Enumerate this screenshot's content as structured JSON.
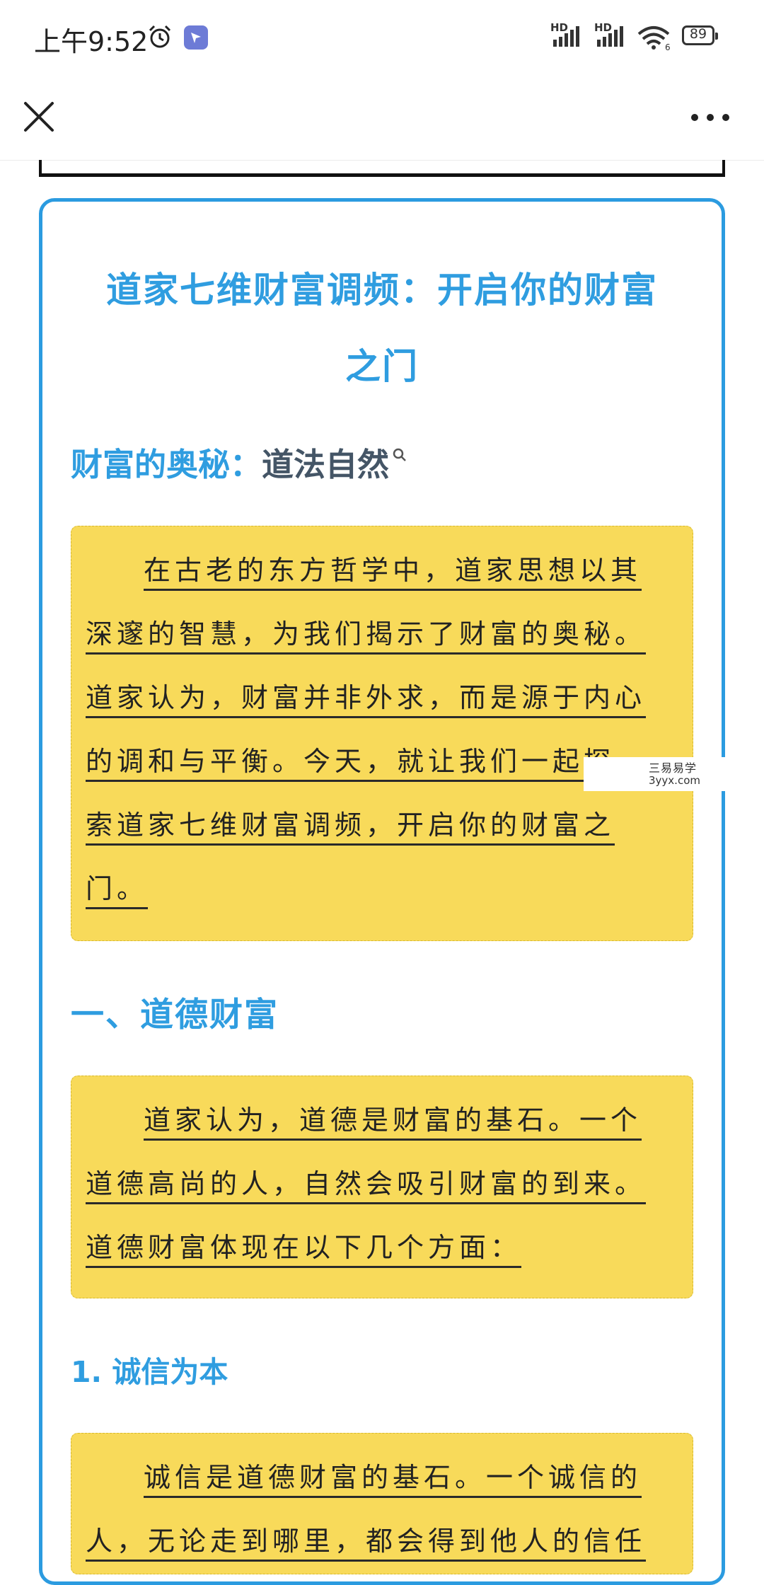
{
  "status": {
    "time": "上午9:52",
    "sim1": "HD",
    "sim2": "HD",
    "wifi_badge": "6",
    "battery": "89"
  },
  "nav": {
    "close_icon": "close-icon",
    "more_icon": "more-icon"
  },
  "article": {
    "title_line1": "道家七维财富调频：开启你的财富",
    "title_line2": "之门",
    "subhead_label": "财富的奥秘：",
    "subhead_text": "道法自然",
    "intro_lines": [
      "在古老的东方哲学中，道家思想以其",
      "深邃的智慧，为我们揭示了财富的奥秘。",
      "道家认为，财富并非外求，而是源于内心",
      "的调和与平衡。今天，就让我们一起探",
      "索道家七维财富调频，开启你的财富之",
      "门。"
    ],
    "section1_title": "一、道德财富",
    "section1_lines": [
      "道家认为，道德是财富的基石。一个",
      "道德高尚的人，自然会吸引财富的到来。",
      "道德财富体现在以下几个方面："
    ],
    "sub1_title": "1. 诚信为本",
    "sub1_lines": [
      "诚信是道德财富的基石。一个诚信的",
      "人，无论走到哪里，都会得到他人的信任"
    ]
  },
  "watermark": {
    "line1": "三易易学",
    "line2": "3yyx.com"
  },
  "colors": {
    "accent": "#2f9de0",
    "highlight": "#f8da5a"
  }
}
